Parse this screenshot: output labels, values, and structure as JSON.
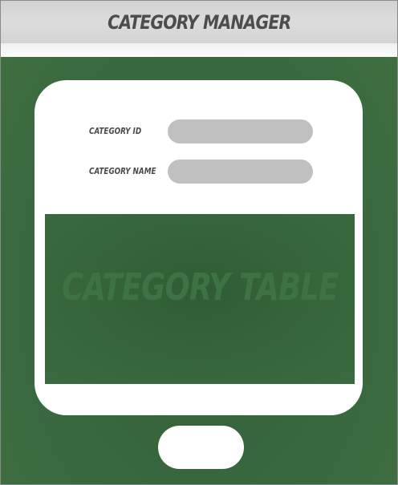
{
  "header": {
    "title": "CATEGORY MANAGER"
  },
  "form": {
    "category_id_label": "CATEGORY ID",
    "category_id_value": "",
    "category_name_label": "CATEGORY NAME",
    "category_name_value": ""
  },
  "table": {
    "placeholder": "CATEGORY TABLE"
  },
  "colors": {
    "background": "#3b6a40",
    "header": "#d4d4d4",
    "input": "#c0c0c0"
  }
}
